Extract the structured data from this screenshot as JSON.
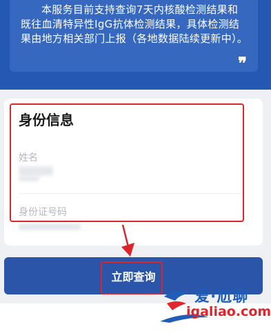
{
  "notice": {
    "text": "本服务目前支持查询7天内核酸检测结果和既往血清特异性IgG抗体检测结果，具体检测结果由地方相关部门上报（各地数据陆续更新中）。",
    "quote_icon": "quote-close-icon",
    "quote_glyph": "❞"
  },
  "form": {
    "section_title": "身份信息",
    "name_label": "姓名",
    "id_label": "身份证号码"
  },
  "submit": {
    "label": "立即查询"
  },
  "watermark": {
    "top": "爱·尬聊",
    "bottom": "igaliao.com"
  },
  "colors": {
    "primary": "#2458b3",
    "notice_card": "#3768bf",
    "button": "#2a55a8",
    "highlight": "#d9262c",
    "watermark_blue": "#1f5db8",
    "watermark_red": "#e0262c"
  }
}
